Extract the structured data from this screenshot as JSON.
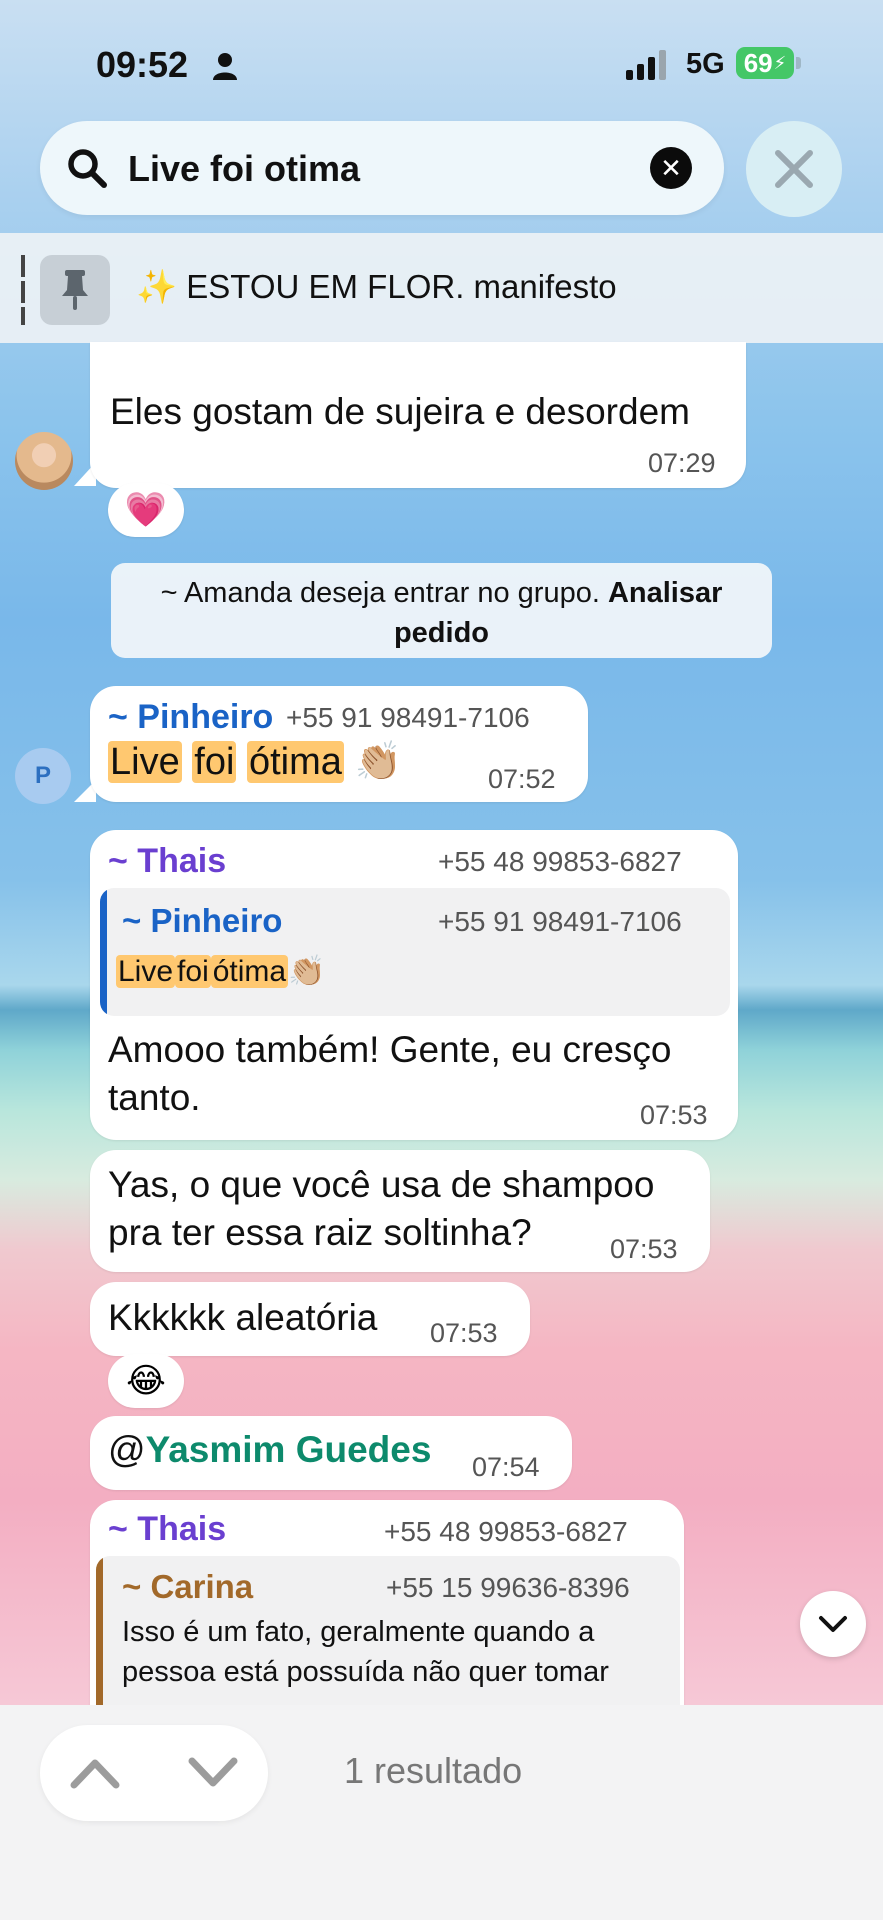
{
  "status_bar": {
    "time": "09:52",
    "network": "5G",
    "battery": "69"
  },
  "search": {
    "query": "Live foi otima"
  },
  "pinned": {
    "emoji": "✨",
    "text": "ESTOU EM FLOR. manifesto"
  },
  "messages": {
    "m1": {
      "text": "Eles gostam de sujeira e desordem",
      "time": "07:29",
      "reaction": "💗"
    },
    "notice": {
      "prefix": "~ Amanda deseja entrar no grupo.",
      "action": "Analisar pedido"
    },
    "m2": {
      "sender": "~ Pinheiro",
      "phone": "+55 91 98491-7106",
      "words": [
        "Live",
        "foi",
        "ótima"
      ],
      "emoji": "👏🏼",
      "time": "07:52",
      "avatar_letter": "P"
    },
    "m3": {
      "sender": "~ Thais",
      "phone": "+55 48 99853-6827",
      "reply_sender": "~ Pinheiro",
      "reply_phone": "+55 91 98491-7106",
      "reply_words": [
        "Live",
        "foi",
        "ótima"
      ],
      "reply_emoji": "👏🏼",
      "line1": "Amooo também! Gente, eu cresço",
      "line2": "tanto.",
      "time": "07:53"
    },
    "m4": {
      "line1": "Yas, o que você usa de shampoo",
      "line2": "pra ter essa raiz soltinha?",
      "time": "07:53"
    },
    "m5": {
      "text": "Kkkkkk aleatória",
      "time": "07:53",
      "reaction": "😂"
    },
    "m6": {
      "at": "@",
      "mention": "Yasmim Guedes",
      "time": "07:54"
    },
    "m7": {
      "sender": "~ Thais",
      "phone": "+55 48 99853-6827",
      "reply_sender": "~ Carina",
      "reply_phone": "+55 15 99636-8396",
      "reply_line1": "Isso é um fato, geralmente quando a",
      "reply_line2": "pessoa está possuída não quer tomar"
    }
  },
  "bottom": {
    "result_count": "1 resultado"
  },
  "colors": {
    "pinheiro": "#1a63c6",
    "thais": "#6a3fd0",
    "carina": "#a2692a",
    "mention": "#0d8a6c",
    "highlight": "#ffc870"
  }
}
